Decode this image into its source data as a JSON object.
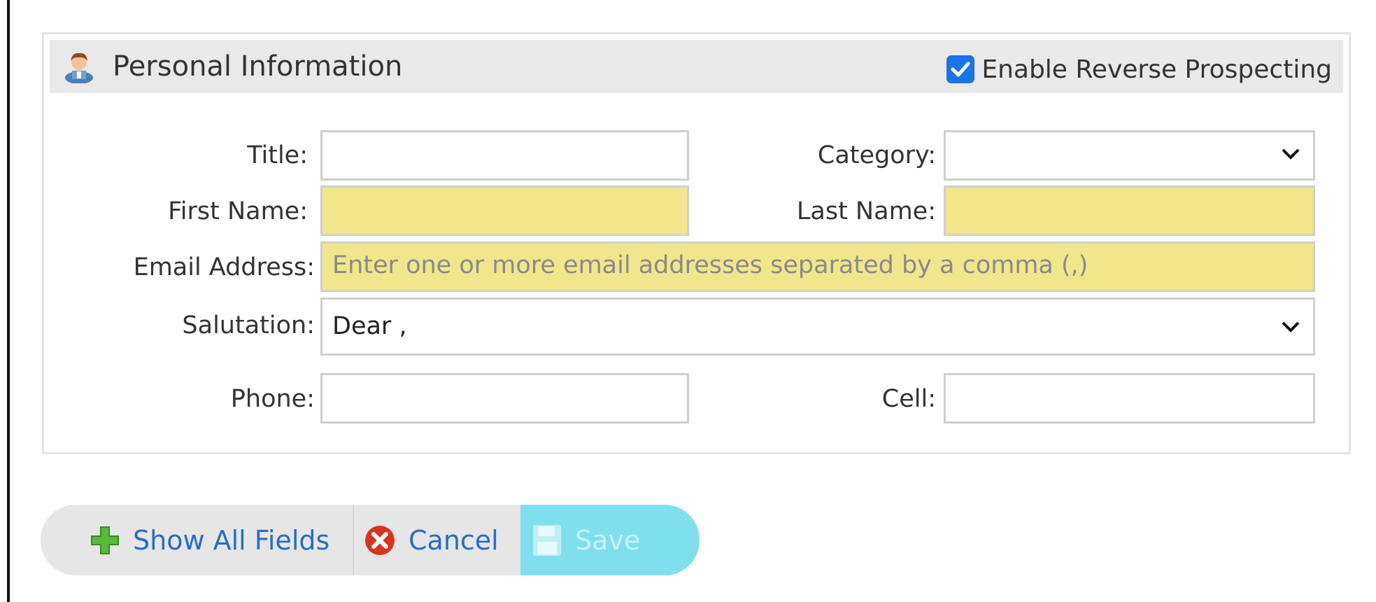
{
  "panel": {
    "title": "Personal Information",
    "icon": "person-icon",
    "reverse_prospecting": {
      "label": "Enable Reverse Prospecting",
      "checked": true
    }
  },
  "form": {
    "title": {
      "label": "Title:",
      "value": ""
    },
    "category": {
      "label": "Category:",
      "value": ""
    },
    "first_name": {
      "label": "First Name:",
      "value": ""
    },
    "last_name": {
      "label": "Last Name:",
      "value": ""
    },
    "email": {
      "label": "Email Address:",
      "value": "",
      "placeholder": "Enter one or more email addresses separated by a comma (,)"
    },
    "salutation": {
      "label": "Salutation:",
      "value": "Dear ,"
    },
    "phone": {
      "label": "Phone:",
      "value": ""
    },
    "cell": {
      "label": "Cell:",
      "value": ""
    }
  },
  "buttons": {
    "show_all": "Show All Fields",
    "cancel": "Cancel",
    "save": "Save"
  },
  "colors": {
    "required_field": "#f0e68c",
    "link": "#2a6cc3",
    "save_disabled": "#7fdfee",
    "checkbox": "#1a73e8"
  }
}
